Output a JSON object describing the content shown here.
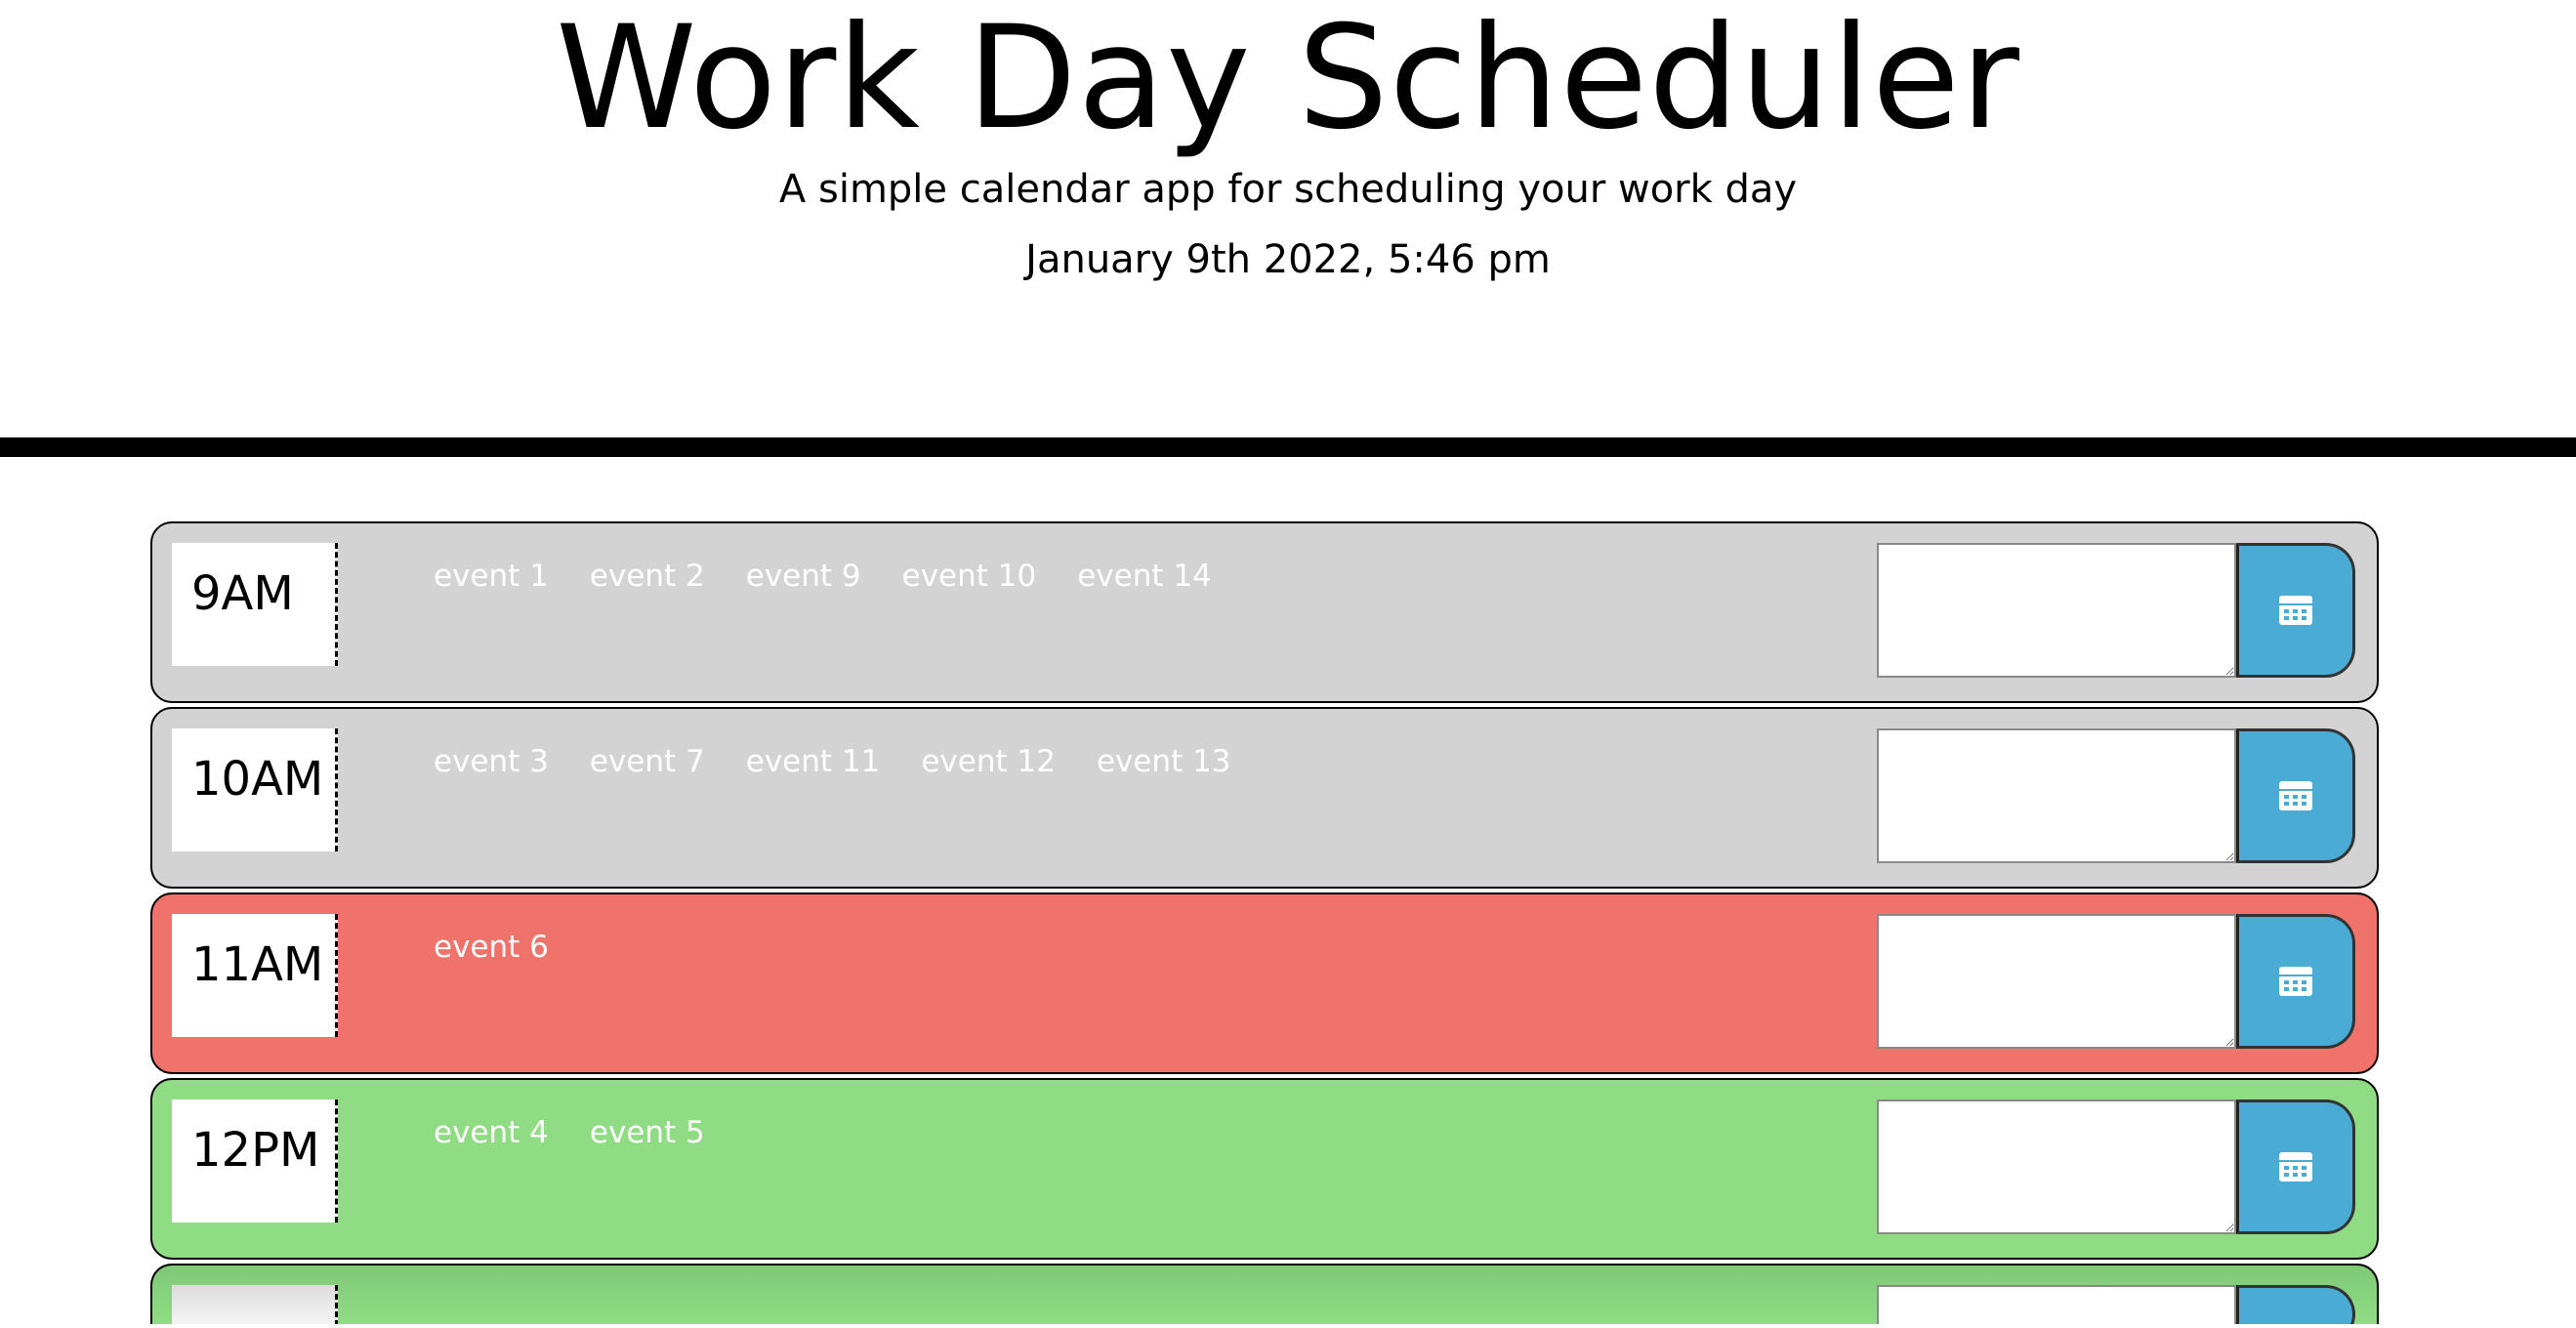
{
  "header": {
    "title": "Work Day Scheduler",
    "subtitle": "A simple calendar app for scheduling your work day",
    "current_day": "January 9th 2022, 5:46 pm"
  },
  "colors": {
    "past": "#d3d3d3",
    "present": "#ef736a",
    "future": "#90dc84",
    "save_button": "#4aabd4"
  },
  "time_blocks": [
    {
      "hour": "9AM",
      "status": "past",
      "events": [
        "event 1",
        "event 2",
        "event 9",
        "event 10",
        "event 14"
      ],
      "input_value": "",
      "save_icon": "calendar-save-icon"
    },
    {
      "hour": "10AM",
      "status": "past",
      "events": [
        "event 3",
        "event 7",
        "event 11",
        "event 12",
        "event 13"
      ],
      "input_value": "",
      "save_icon": "calendar-save-icon"
    },
    {
      "hour": "11AM",
      "status": "present",
      "events": [
        "event 6"
      ],
      "input_value": "",
      "save_icon": "calendar-save-icon"
    },
    {
      "hour": "12PM",
      "status": "future",
      "events": [
        "event 4",
        "event 5"
      ],
      "input_value": "",
      "save_icon": "calendar-save-icon"
    }
  ]
}
